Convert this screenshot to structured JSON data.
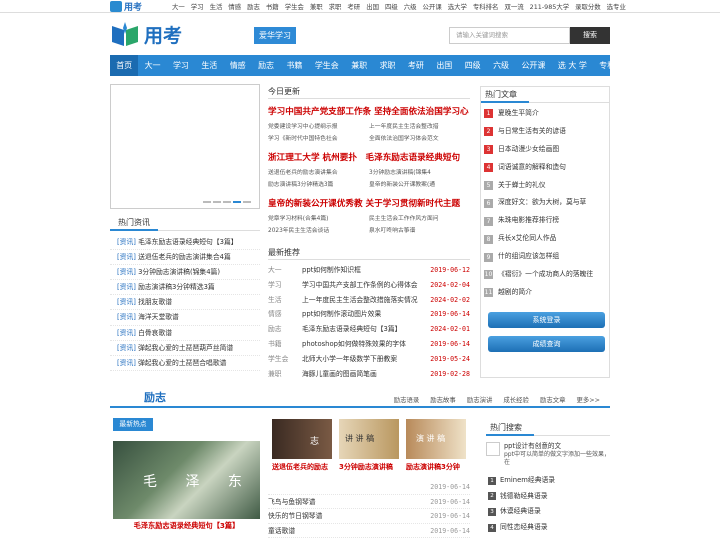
{
  "topbar": {
    "brand": "用考",
    "links": [
      "大一",
      "学习",
      "生活",
      "情感",
      "励志",
      "书籍",
      "学生会",
      "兼职",
      "求职",
      "考研",
      "出国",
      "四级",
      "六级",
      "公开课",
      "选大学",
      "专科排名",
      "双一流",
      "211-985大学",
      "录取分数",
      "选专业"
    ]
  },
  "header": {
    "logo_text": "用考",
    "slogan": "爱华学习",
    "search_placeholder": "请输入关键词搜索",
    "search_button": "搜索"
  },
  "nav": [
    "首页",
    "大一",
    "学习",
    "生活",
    "情感",
    "励志",
    "书籍",
    "学生会",
    "兼职",
    "求职",
    "考研",
    "出国",
    "四级",
    "六级",
    "公开课",
    "选 大 学",
    "专科排名"
  ],
  "hot_info": {
    "title": "热门资讯",
    "items": [
      {
        "tag": "[资讯]",
        "text": "毛泽东励志语录经典短句【3篇】"
      },
      {
        "tag": "[资讯]",
        "text": "送退伍老兵的励志演讲集合4篇"
      },
      {
        "tag": "[资讯]",
        "text": "3分钟励志演讲稿(锦集4篇)"
      },
      {
        "tag": "[资讯]",
        "text": "励志演讲稿3分钟精选3篇"
      },
      {
        "tag": "[资讯]",
        "text": "找朋友歌谱"
      },
      {
        "tag": "[资讯]",
        "text": "海洋天堂歌谱"
      },
      {
        "tag": "[资讯]",
        "text": "白骨哀歌谱"
      },
      {
        "tag": "[资讯]",
        "text": "弹起我心爱的土琵琶葫芦丝简谱"
      },
      {
        "tag": "[资讯]",
        "text": "弹起我心爱的土琵琶合唱歌谱"
      }
    ]
  },
  "today": {
    "title": "今日更新",
    "blocks": [
      {
        "headline": "学习中国共产党支部工作条 坚持全面依法治国学习心",
        "pairs": [
          "党委建设学习中心提纲示报",
          "上一年度民主生活会整改措",
          "学习《新时代中国特色社会",
          "全面依法治国学习体会范文"
        ]
      },
      {
        "headline": "浙江理工大学 杭州要扑　毛泽东励志语录经典短句",
        "pairs": [
          "送退伍老兵的励志演讲集合",
          "3分钟励志演讲稿(锦集4",
          "励志演讲稿3分钟精选3篇",
          "皇帝的新装公开课教案(通"
        ]
      },
      {
        "headline": "皇帝的新装公开课优秀教 关于学习贯彻新时代主题",
        "pairs": [
          "党章学习材料(合集4篇)",
          "民主生活会工作作风方面问",
          "2023年民主生活会谈话",
          "泉水叮咚响古筝谱"
        ]
      }
    ]
  },
  "latest": {
    "title": "最新推荐",
    "rows": [
      {
        "cat": "大一",
        "title": "ppt如何制作知识框",
        "date": "2019-06-12"
      },
      {
        "cat": "学习",
        "title": "学习中国共产支部工作条例的心得体会",
        "date": "2024-02-04"
      },
      {
        "cat": "生活",
        "title": "上一年度民主生活会整改措施落实情况",
        "date": "2024-02-02"
      },
      {
        "cat": "情感",
        "title": "ppt如何制作滚动图片效果",
        "date": "2019-06-14"
      },
      {
        "cat": "励志",
        "title": "毛泽东励志语录经典短句【3篇】",
        "date": "2024-02-01"
      },
      {
        "cat": "书籍",
        "title": "photoshop如何做特殊效果的字体",
        "date": "2019-06-14"
      },
      {
        "cat": "学生会",
        "title": "北师大小学一年级数学下册教案",
        "date": "2019-05-24"
      },
      {
        "cat": "兼职",
        "title": "海豚儿童画的图画简笔画",
        "date": "2019-02-28"
      }
    ]
  },
  "hot_articles": {
    "title": "热门文章",
    "items": [
      "夏晚生平简介",
      "与日常生活有关的谚语",
      "日本动漫少女绘画图",
      "词语诚意的解释和造句",
      "关于蝉士的礼仪",
      "深度好文：欲为大树，莫与草",
      "朱珠电影推荐排行榜",
      "兵长x艾伦同人作品",
      "什的组词应该怎样组",
      "《褶衍》一个成功商人的落魄往",
      "越剧的简介"
    ]
  },
  "buttons": {
    "system": "系统登录",
    "score": "成绩查询"
  },
  "section": {
    "title": "励志",
    "links": [
      "励志语录",
      "励志故事",
      "励志演讲",
      "成长经验",
      "励志文章",
      "更多>>"
    ]
  },
  "new_hot": {
    "label": "最新热点",
    "image_text": "毛 泽 东",
    "caption": "毛泽东励志语录经典短句【3篇】"
  },
  "thumbs": [
    {
      "caption": "送退伍老兵的励志",
      "img_text": "志"
    },
    {
      "caption": "3分钟励志演讲稿",
      "img_text": "讲 讲 稿"
    },
    {
      "caption": "励志演讲稿3分钟",
      "img_text": "演 讲 稿"
    }
  ],
  "bottom_list": [
    {
      "title": "",
      "date": "2019-06-14"
    },
    {
      "title": "飞鸟与鱼钢琴谱",
      "date": "2019-06-14"
    },
    {
      "title": "快乐的节日钢琴谱",
      "date": "2019-06-14"
    },
    {
      "title": "童话歌谱",
      "date": "2019-06-14"
    }
  ],
  "hot_search": {
    "title": "热门搜索",
    "feature_title": "ppt设计有创意的文",
    "feature_desc": "ppt中可以简单的做文字添加一些效果，在",
    "items": [
      "Eminem经典语录",
      "钱德勒经典语录",
      "休谟经典语录",
      "同性恋经典语录"
    ]
  }
}
